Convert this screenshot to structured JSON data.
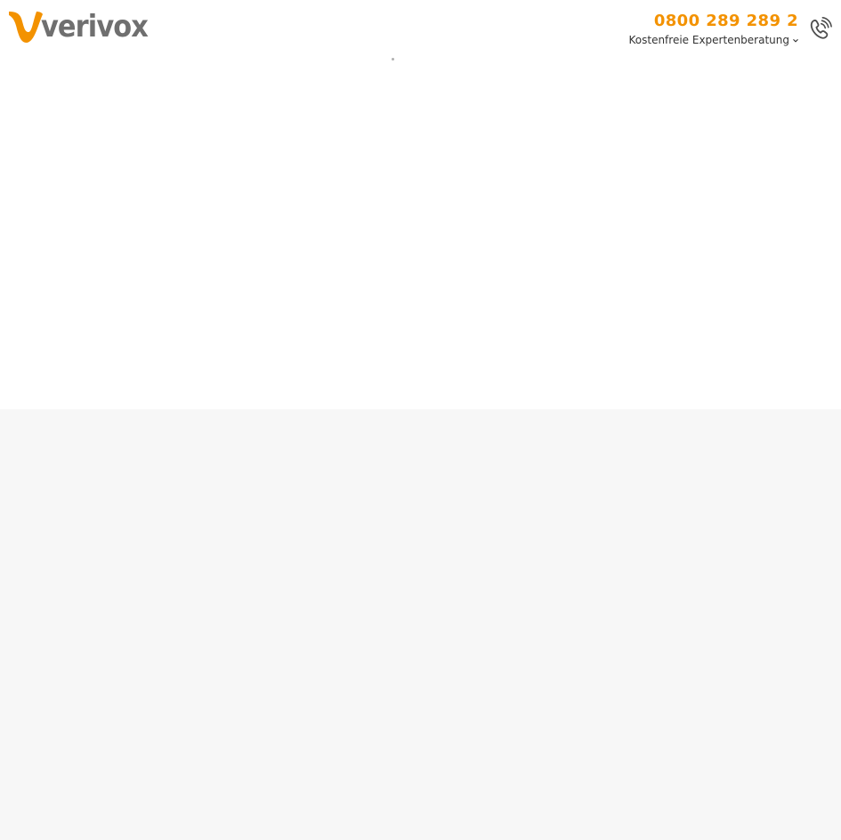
{
  "header": {
    "logo_text": "verivox",
    "phone_number": "0800 289 289 2",
    "hotline_caption": "Kostenfreie Expertenberatung"
  },
  "icons": {
    "phone": "phone-icon",
    "chevron": "chevron-down-icon"
  },
  "colors": {
    "brand_orange": "#f39200",
    "logo_gray": "#6f6f6f",
    "text_dark": "#333333",
    "top_background": "#ffffff",
    "lower_background": "#f7f7f7"
  }
}
